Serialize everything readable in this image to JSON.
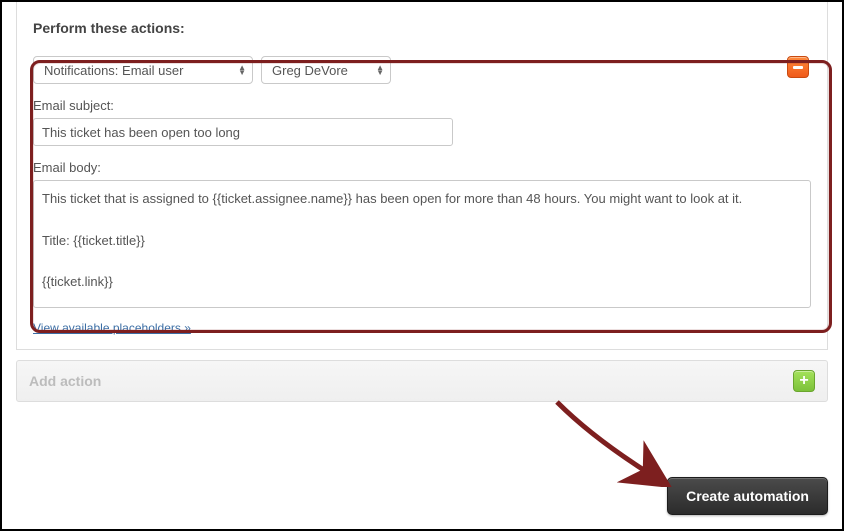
{
  "section_title": "Perform these actions:",
  "action": {
    "type_select": "Notifications: Email user",
    "user_select": "Greg DeVore",
    "subject_label": "Email subject:",
    "subject_value": "This ticket has been open too long",
    "body_label": "Email body:",
    "body_value": "This ticket that is assigned to {{ticket.assignee.name}} has been open for more than 48 hours. You might want to look at it.\n\nTitle: {{ticket.title}}\n\n{{ticket.link}}"
  },
  "placeholders_link": "View available placeholders »",
  "add_action_label": "Add action",
  "create_button": "Create automation",
  "colors": {
    "highlight_border": "#7d1f1f",
    "remove_btn": "#f05a1a",
    "add_btn": "#7cc13a",
    "create_btn": "#2b2b2b"
  }
}
